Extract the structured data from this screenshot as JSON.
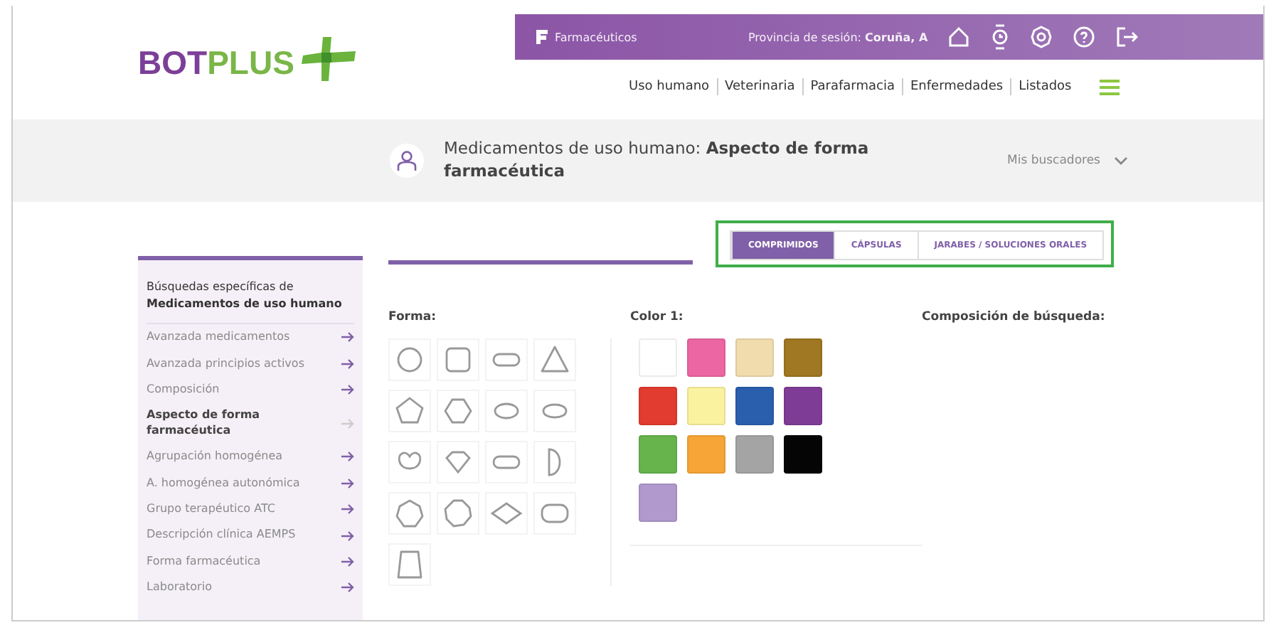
{
  "logo": {
    "part_1": "BOT",
    "part_2": "PLUS"
  },
  "top_bar": {
    "brand": "Farmacéuticos",
    "session_label": "Provincia de sesión:",
    "session_value": "Coruña, A"
  },
  "nav": [
    {
      "label": "Uso humano"
    },
    {
      "label": "Veterinaria"
    },
    {
      "label": "Parafarmacia"
    },
    {
      "label": "Enfermedades"
    },
    {
      "label": "Listados"
    }
  ],
  "header": {
    "title_plain": "Medicamentos de uso humano: ",
    "title_bold": "Aspecto de forma farmacéutica",
    "menu": "Mis buscadores"
  },
  "tabs": [
    {
      "label": "COMPRIMIDOS",
      "selected": true
    },
    {
      "label": "CÁPSULAS",
      "selected": false
    },
    {
      "label": "JARABES / SOLUCIONES ORALES",
      "selected": false
    }
  ],
  "sidebar": {
    "heading": "Búsquedas específicas de",
    "heading_bold": "Medicamentos de uso humano",
    "items": [
      {
        "label": "Avanzada medicamentos",
        "selected": false
      },
      {
        "label": "Avanzada principios activos",
        "selected": false
      },
      {
        "label": "Composición",
        "selected": false
      },
      {
        "label": "Aspecto de forma farmacéutica",
        "selected": true
      },
      {
        "label": "Agrupación homogénea",
        "selected": false
      },
      {
        "label": "A. homogénea autonómica",
        "selected": false
      },
      {
        "label": "Grupo terapéutico ATC",
        "selected": false
      },
      {
        "label": "Descripción clínica AEMPS",
        "selected": false
      },
      {
        "label": "Forma farmacéutica",
        "selected": false
      },
      {
        "label": "Laboratorio",
        "selected": false
      }
    ]
  },
  "forma": {
    "label": "Forma:",
    "shapes": [
      {
        "kind": "circle"
      },
      {
        "kind": "square"
      },
      {
        "kind": "capsule"
      },
      {
        "kind": "triangle"
      },
      {
        "kind": "pentagon"
      },
      {
        "kind": "hexagon"
      },
      {
        "kind": "ellipse"
      },
      {
        "kind": "oval"
      },
      {
        "kind": "heart"
      },
      {
        "kind": "diamond"
      },
      {
        "kind": "capsule"
      },
      {
        "kind": "half"
      },
      {
        "kind": "heptagon"
      },
      {
        "kind": "octagon"
      },
      {
        "kind": "rhombus"
      },
      {
        "kind": "rounded"
      },
      {
        "kind": "trapezoid"
      }
    ]
  },
  "color_1": {
    "label": "Color 1:",
    "swatches": [
      {
        "color": "#ffffff"
      },
      {
        "color": "#ec66a4"
      },
      {
        "color": "#f1dcae"
      },
      {
        "color": "#a07722"
      },
      {
        "color": "#e23b2f"
      },
      {
        "color": "#fbf29f"
      },
      {
        "color": "#2a5fad"
      },
      {
        "color": "#7f3c96"
      },
      {
        "color": "#67b44c"
      },
      {
        "color": "#f7a536"
      },
      {
        "color": "#a4a4a4"
      },
      {
        "color": "#050505"
      },
      {
        "color": "#b199cd"
      }
    ]
  },
  "composition": {
    "label": "Composición de búsqueda:"
  }
}
